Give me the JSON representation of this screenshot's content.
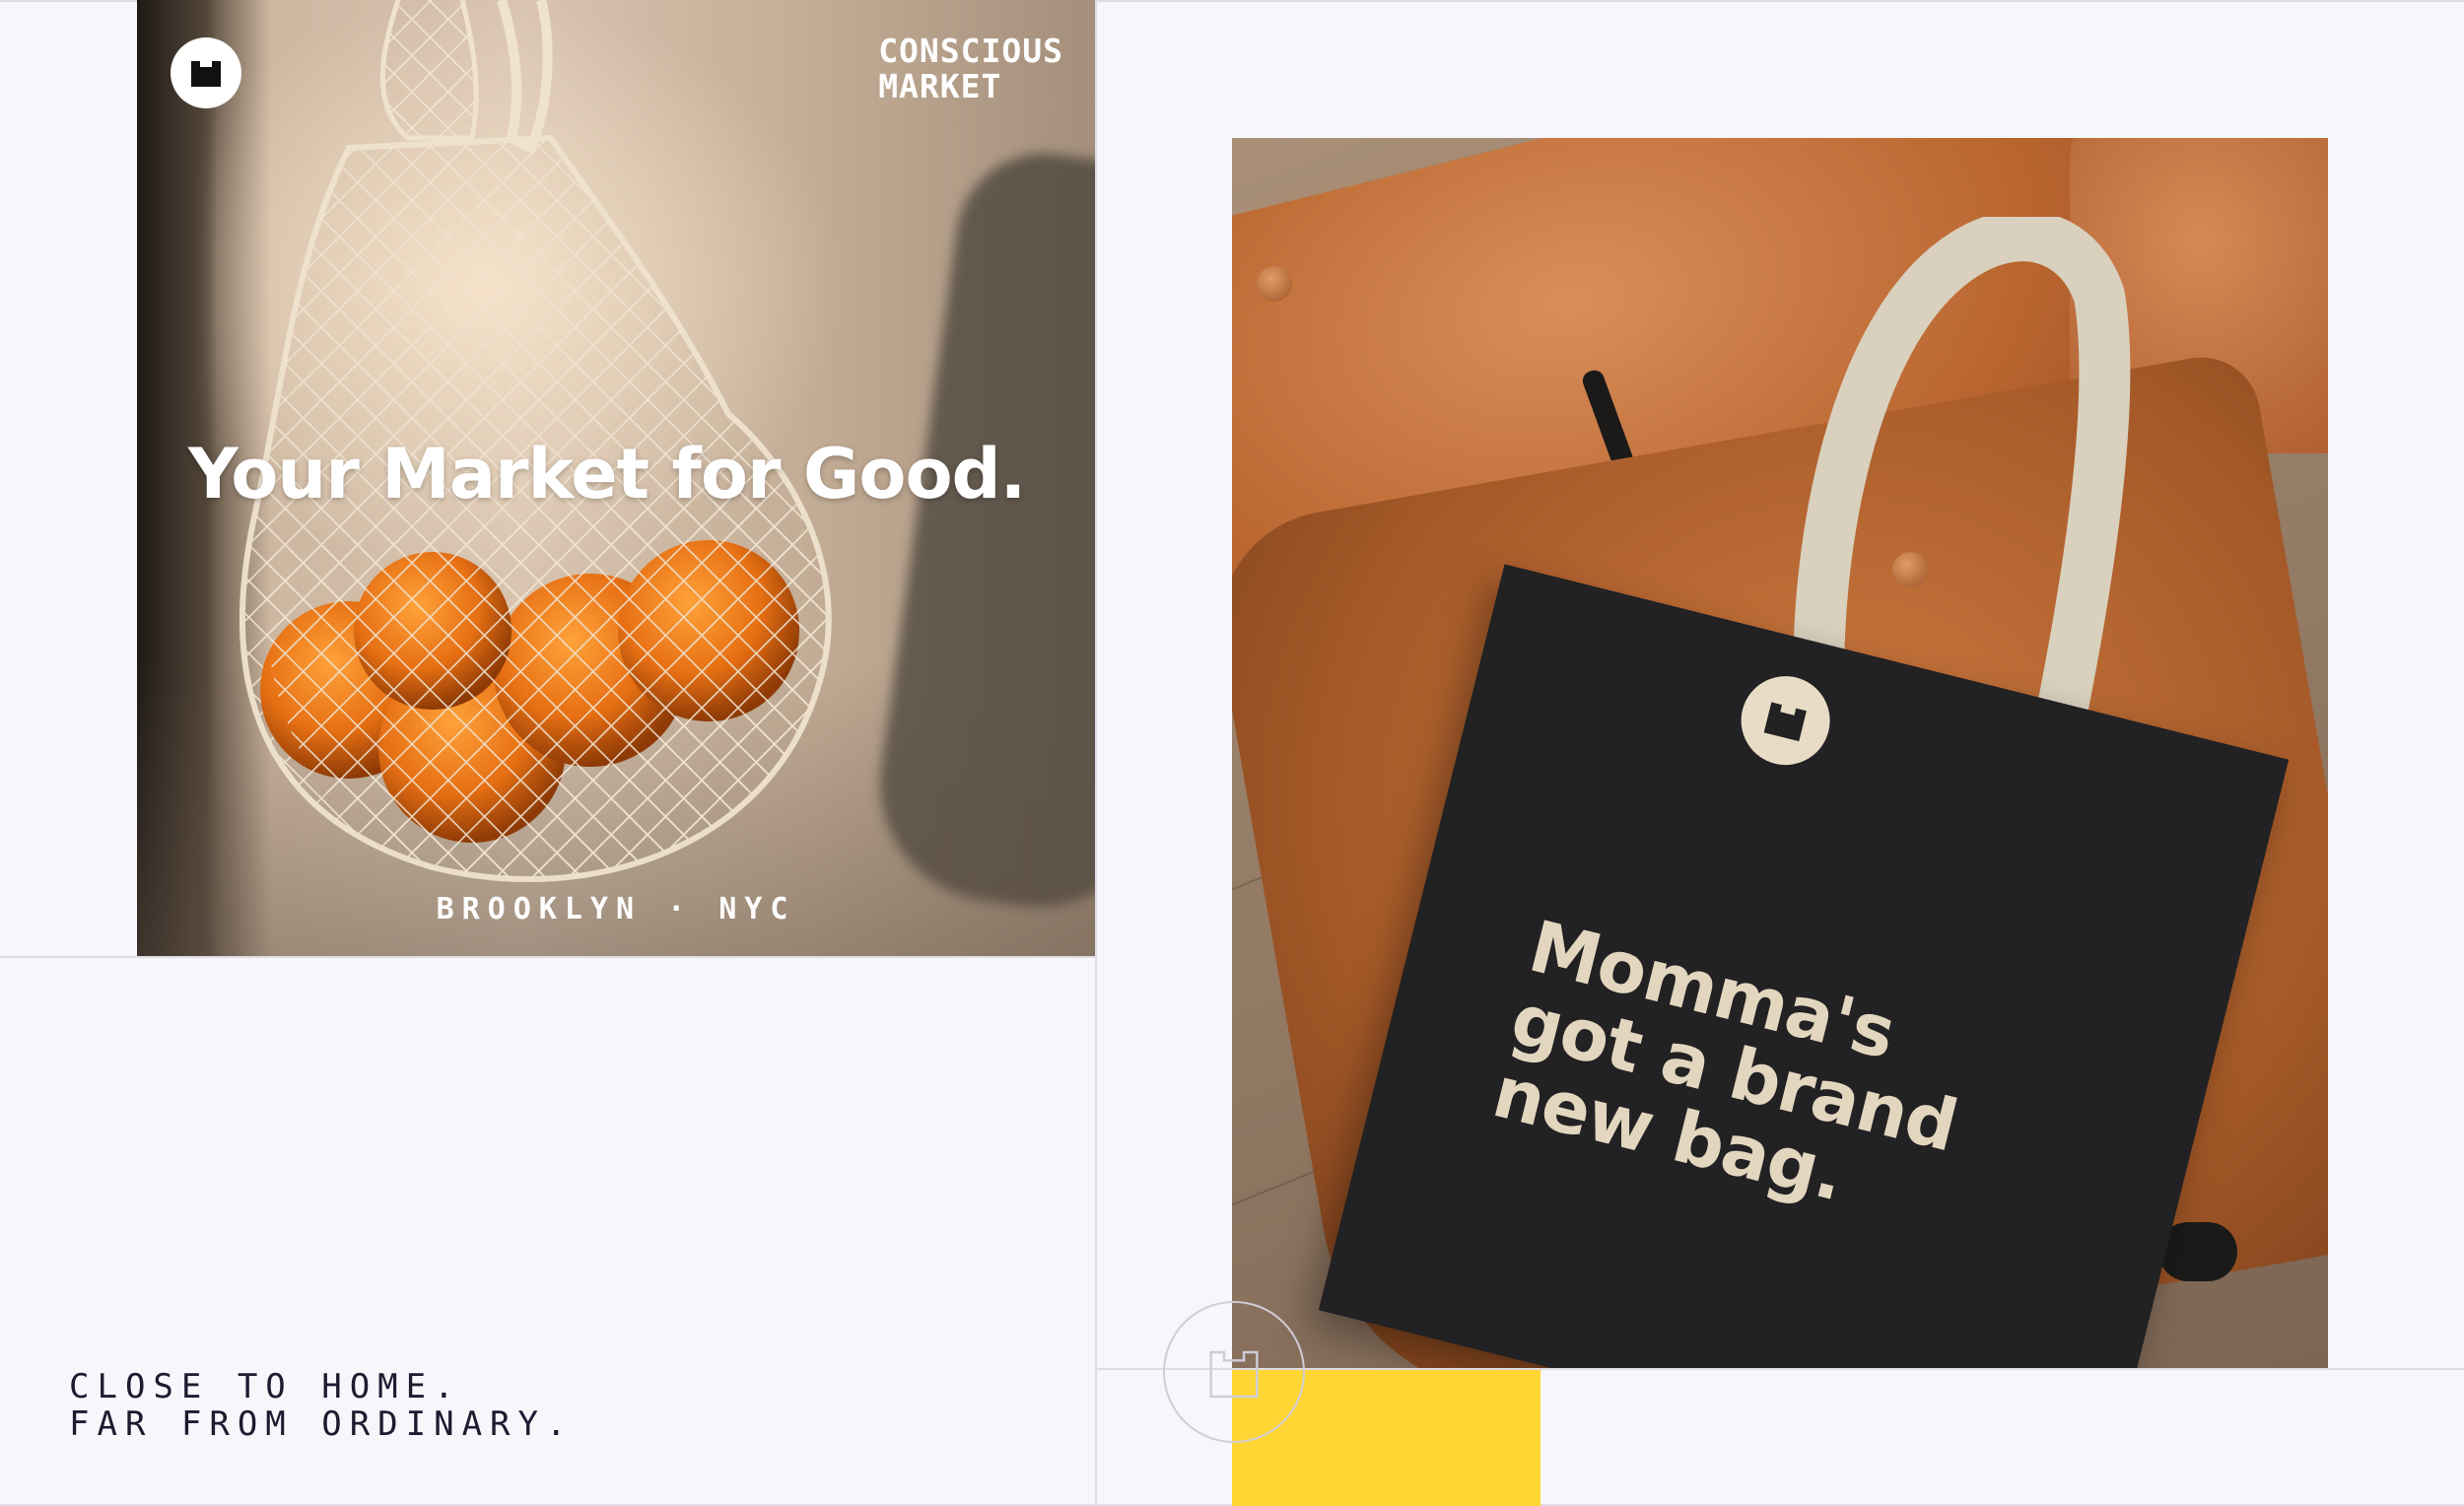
{
  "brand": {
    "name_line1": "CONSCIOUS",
    "name_line2": "MARKET",
    "logo_icon": "market-bag-icon"
  },
  "poster": {
    "headline": "Your Market for Good.",
    "location": "BROOKLYN · NYC"
  },
  "tagline": {
    "line1": "CLOSE TO HOME.",
    "line2": "FAR FROM ORDINARY."
  },
  "tote": {
    "line1": "Momma's",
    "line2": "got a brand",
    "line3": "new bag."
  },
  "colors": {
    "background": "#f8f6fb",
    "accent_yellow": "#ffd633",
    "ink": "#1e1a30",
    "tote_black": "#222123",
    "tote_print": "#e3d6bf"
  }
}
